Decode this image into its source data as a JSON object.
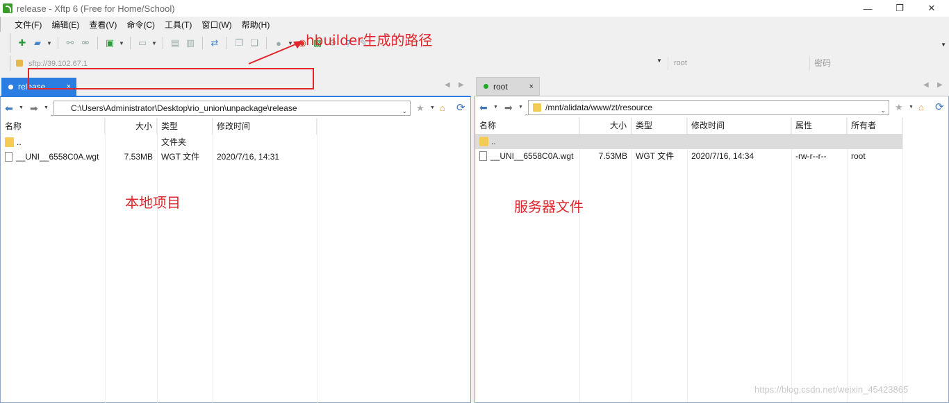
{
  "window": {
    "title": "release - Xftp 6 (Free for Home/School)",
    "min": "—",
    "max": "❐",
    "close": "✕"
  },
  "menu": [
    "文件(F)",
    "编辑(E)",
    "查看(V)",
    "命令(C)",
    "工具(T)",
    "窗口(W)",
    "帮助(H)"
  ],
  "address": {
    "host": "sftp://39.102.67.1",
    "user_placeholder": "root",
    "password_placeholder": "密码"
  },
  "tabs": {
    "left": {
      "label": "release",
      "close": "×"
    },
    "right": {
      "label": "root",
      "close": "×"
    }
  },
  "local": {
    "path": "C:\\Users\\Administrator\\Desktop\\rio_union\\unpackage\\release",
    "columns": [
      "名称",
      "大小",
      "类型",
      "修改时间"
    ],
    "rows": [
      {
        "name": "..",
        "size": "",
        "type": "文件夹",
        "modified": ""
      },
      {
        "name": "__UNI__6558C0A.wgt",
        "size": "7.53MB",
        "type": "WGT 文件",
        "modified": "2020/7/16, 14:31"
      }
    ]
  },
  "remote": {
    "path": "/mnt/alidata/www/zt/resource",
    "columns": [
      "名称",
      "大小",
      "类型",
      "修改时间",
      "属性",
      "所有者"
    ],
    "rows": [
      {
        "name": "..",
        "size": "",
        "type": "",
        "modified": "",
        "attr": "",
        "owner": ""
      },
      {
        "name": "__UNI__6558C0A.wgt",
        "size": "7.53MB",
        "type": "WGT 文件",
        "modified": "2020/7/16, 14:34",
        "attr": "-rw-r--r--",
        "owner": "root"
      }
    ]
  },
  "annotations": {
    "top": "hbuilder生成的路径",
    "local": "本地项目",
    "server": "服务器文件",
    "color": "#e0262c"
  },
  "watermark": "https://blog.csdn.net/weixin_45423865"
}
